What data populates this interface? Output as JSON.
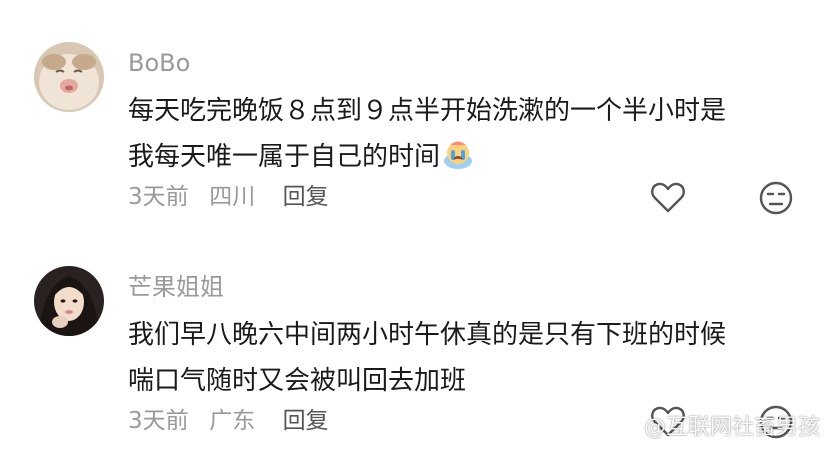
{
  "comments": [
    {
      "username": "BoBo",
      "lines": [
        "每天吃完晚饭８点到９点半开始洗漱的一个半小时是",
        "我每天唯一属于自己的时间"
      ],
      "emoji": "crying-emoji",
      "time": "3天前",
      "location": "四川",
      "reply_label": "回复",
      "like_icon": "heart-icon",
      "dislike_icon": "frown-face-icon"
    },
    {
      "username": "芒果姐姐",
      "lines": [
        "我们早八晚六中间两小时午休真的是只有下班的时候",
        "喘口气随时又会被叫回去加班"
      ],
      "time": "3天前",
      "location": "广东",
      "reply_label": "回复",
      "like_icon": "heart-icon",
      "dislike_icon": "frown-face-icon"
    }
  ],
  "watermark": {
    "text": "@互联网社畜男孩",
    "icon": "weibo-icon"
  }
}
